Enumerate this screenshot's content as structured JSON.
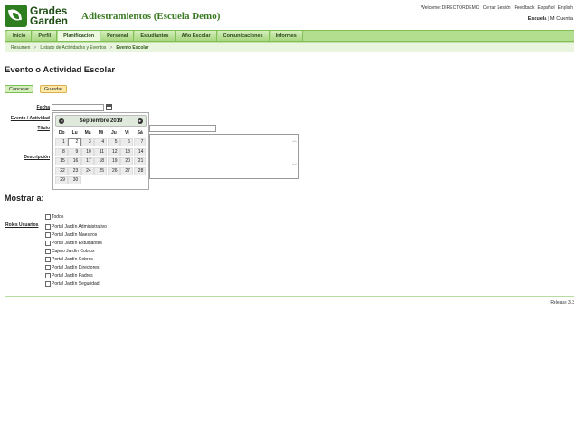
{
  "brand": {
    "line1": "Grades",
    "line2": "Garden"
  },
  "app_title": "Adiestramientos (Escuela Demo)",
  "top": {
    "welcome": "Welcome: DIRECTORDEMO",
    "logout": "Cerrar Sesión",
    "feedback": "Feedback",
    "lang_es": "Español",
    "lang_en": "English"
  },
  "school": {
    "label": "Escuela",
    "sep": "|",
    "account": "Mi Cuenta"
  },
  "nav": [
    "Inicio",
    "Perfil",
    "Planificación",
    "Personal",
    "Estudiantes",
    "Año Escolar",
    "Comunicaciones",
    "Informes"
  ],
  "nav_active": "Planificación",
  "breadcrumb": {
    "home": "Resumen",
    "list": "Listado de Actividades y Eventos",
    "current": "Evento Escolar",
    "sep": ">"
  },
  "page_title": "Evento o Actividad Escolar",
  "buttons": {
    "cancel": "Cancelar",
    "save": "Guardar"
  },
  "form": {
    "date_label": "Fecha",
    "event_label": "Evento / Actividad",
    "title_label": "Título",
    "desc_label": "Descripción",
    "date_value": "",
    "title_value": "",
    "desc_value": ""
  },
  "calendar": {
    "month": "Septiembre 2019",
    "prev": "◄",
    "next": "►",
    "days": [
      "Do",
      "Lu",
      "Ma",
      "Mi",
      "Ju",
      "Vi",
      "Sá"
    ],
    "weeks": [
      [
        "1",
        "2",
        "3",
        "4",
        "5",
        "6",
        "7"
      ],
      [
        "8",
        "9",
        "10",
        "11",
        "12",
        "13",
        "14"
      ],
      [
        "15",
        "16",
        "17",
        "18",
        "19",
        "20",
        "21"
      ],
      [
        "22",
        "23",
        "24",
        "25",
        "26",
        "27",
        "28"
      ],
      [
        "29",
        "30",
        "",
        "",
        "",
        "",
        ""
      ]
    ],
    "today": "2"
  },
  "show_to": {
    "title": "Mostrar a:",
    "roles_label": "Roles Usuarios",
    "roles": [
      "Todos",
      "Portal Jardín Administrativo",
      "Portal Jardín Maestros",
      "Portal Jardín Estudiantes",
      "Cajero Jardín Cobros",
      "Portal Jardín Cobros",
      "Portal Jardín Directores",
      "Portal Jardín Padres",
      "Portal Jardín Seguridad"
    ]
  },
  "release": "Release 3.3"
}
